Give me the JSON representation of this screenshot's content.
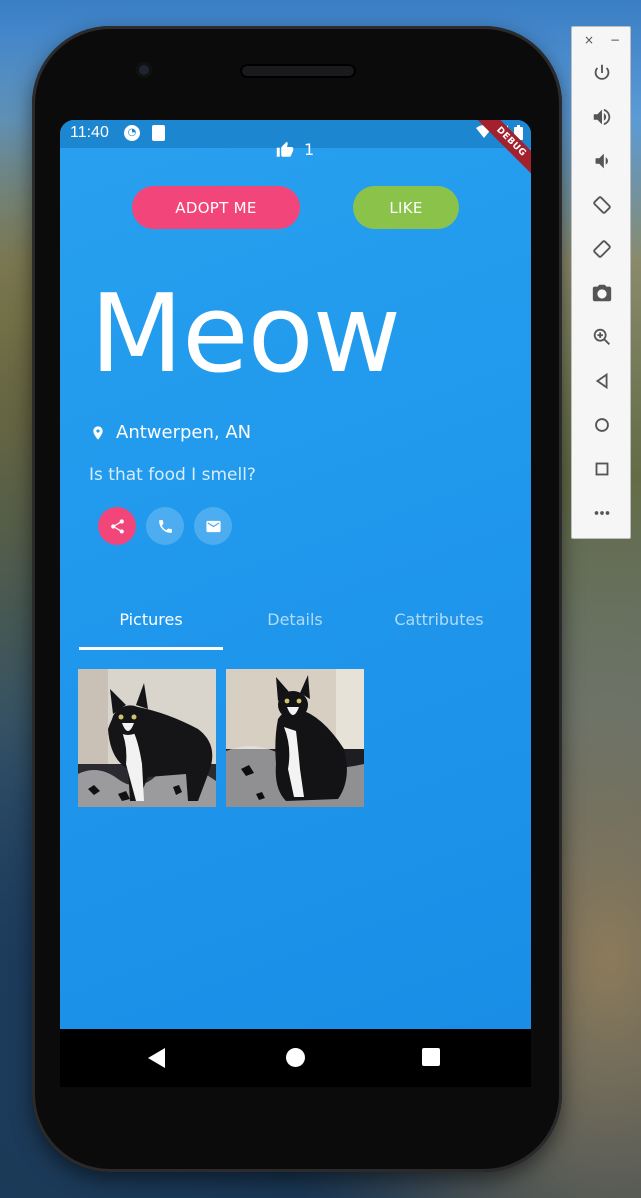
{
  "status_bar": {
    "time": "11:40",
    "debug_label": "DEBUG"
  },
  "likes": {
    "count": "1"
  },
  "buttons": {
    "adopt_label": "ADOPT ME",
    "like_label": "LIKE"
  },
  "pet": {
    "name": "Meow",
    "location": "Antwerpen, AN",
    "tagline": "Is that food I smell?"
  },
  "tabs": [
    {
      "label": "Pictures",
      "active": true
    },
    {
      "label": "Details",
      "active": false
    },
    {
      "label": "Cattributes",
      "active": false
    }
  ],
  "actions": [
    "share-icon",
    "phone-icon",
    "mail-icon"
  ],
  "emulator": {
    "close": "×",
    "minimize": "−",
    "buttons": [
      "power-icon",
      "volume-up-icon",
      "volume-down-icon",
      "rotate-left-icon",
      "rotate-right-icon",
      "camera-icon",
      "zoom-icon",
      "back-icon",
      "home-icon",
      "overview-icon",
      "more-icon"
    ]
  },
  "colors": {
    "primary": "#1f97ec",
    "accent_pink": "#f2467a",
    "accent_green": "#8ac24a"
  }
}
